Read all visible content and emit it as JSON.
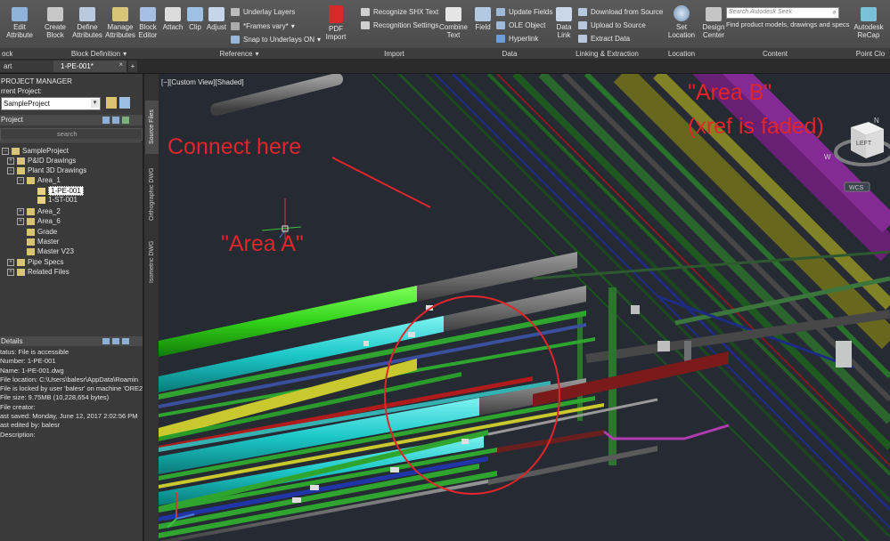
{
  "ribbon": {
    "edit_attribute": "Edit\nAttribute",
    "create_block": "Create\nBlock",
    "define_attributes": "Define\nAttributes",
    "manage_attributes": "Manage\nAttributes",
    "block_editor": "Block\nEditor",
    "attach": "Attach",
    "clip": "Clip",
    "adjust": "Adjust",
    "underlay_layers": "Underlay Layers",
    "frames_vary": "*Frames vary*",
    "snap_to_underlays": "Snap to Underlays ON",
    "pdf_import": "PDF\nImport",
    "recognize_shx": "Recognize SHX Text",
    "recognition_settings": "Recognition Settings",
    "combine_text": "Combine\nText",
    "field": "Field",
    "update_fields": "Update Fields",
    "ole_object": "OLE Object",
    "hyperlink": "Hyperlink",
    "data_link": "Data\nLink",
    "download_from_source": "Download from Source",
    "upload_to_source": "Upload to Source",
    "extract_data": "Extract  Data",
    "set_location": "Set\nLocation",
    "design_center": "Design\nCenter",
    "search_placeholder": "Search Autodesk Seek",
    "find_products": "Find product models, drawings and specs",
    "recap": "Autodesk\nReCap",
    "panels": {
      "block": "ock",
      "block_definition": "Block Definition",
      "reference": "Reference",
      "import": "Import",
      "data": "Data",
      "linking": "Linking & Extraction",
      "location": "Location",
      "content": "Content",
      "point_cloud": "Point Clo"
    }
  },
  "tabs": {
    "start": "art",
    "active": "1-PE-001*",
    "add": "+"
  },
  "project_manager": {
    "title": "PROJECT MANAGER",
    "current_project_label": "rrent Project:",
    "current_project": "SampleProject",
    "project_label": "Project",
    "search_placeholder": "search",
    "tree": [
      {
        "label": "SampleProject",
        "level": 0
      },
      {
        "label": "P&ID Drawings",
        "level": 1
      },
      {
        "label": "Plant 3D Drawings",
        "level": 1
      },
      {
        "label": "Area_1",
        "level": 2
      },
      {
        "label": "1-PE-001",
        "level": 3
      },
      {
        "label": "1-ST-001",
        "level": 3
      },
      {
        "label": "Area_2",
        "level": 2
      },
      {
        "label": "Area_6",
        "level": 2
      },
      {
        "label": "Grade",
        "level": 2
      },
      {
        "label": "Master",
        "level": 2
      },
      {
        "label": "Master V23",
        "level": 2
      },
      {
        "label": "Pipe Specs",
        "level": 1
      },
      {
        "label": "Related Files",
        "level": 1
      }
    ],
    "details_title": "Details",
    "details": [
      "tatus: File is accessible",
      "Number: 1-PE-001",
      "Name: 1-PE-001.dwg",
      "File location:  C:\\Users\\balesr\\AppData\\Roamin",
      "File is locked by user 'balesr' on machine 'ORE2",
      "File size: 9.75MB (10,228,654 bytes)",
      "File creator:",
      "ast saved: Monday, June 12, 2017 2:02:56 PM",
      "ast edited by:  balesr",
      "Description:"
    ]
  },
  "side_tabs": {
    "source_files": "Source Files",
    "orthographic": "Orthographic DWG",
    "isometric": "Isometric DWG"
  },
  "viewport": {
    "label": "[−][Custom View][Shaded]",
    "annotation_connect": "Connect here",
    "annotation_area_a": "\"Area A\"",
    "annotation_area_b_line1": "\"Area B\"",
    "annotation_area_b_line2": "(xref is faded)",
    "viewcube_face": "LEFT",
    "compass_n": "N",
    "compass_w": "W",
    "wcs": "WCS",
    "annotation_color": "#e0262a"
  }
}
